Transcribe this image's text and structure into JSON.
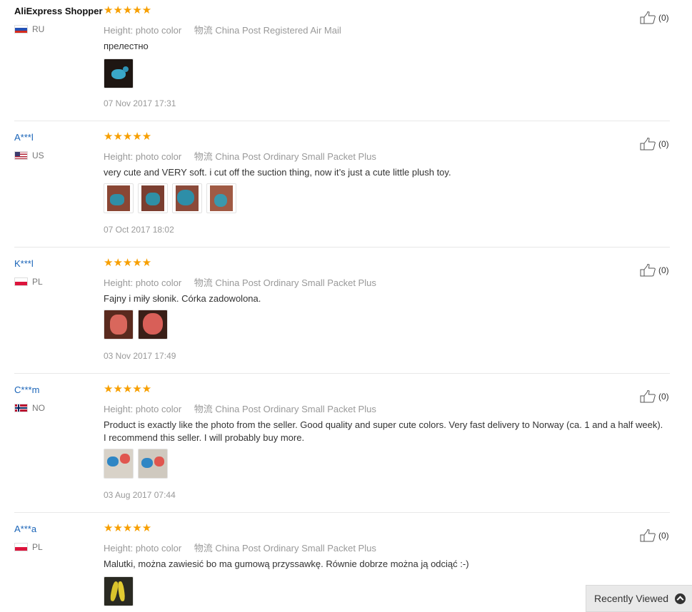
{
  "reviews": [
    {
      "user": "AliExpress Shopper",
      "country": "RU",
      "stars": "★★★★★",
      "height_label": "Height:",
      "height_value": "photo color",
      "logistics_label": "物流",
      "logistics_value": "China Post Registered Air Mail",
      "text": "прелестно",
      "date": "07 Nov 2017 17:31",
      "useful": "(0)"
    },
    {
      "user": "A***l",
      "country": "US",
      "stars": "★★★★★",
      "height_label": "Height:",
      "height_value": "photo color",
      "logistics_label": "物流",
      "logistics_value": "China Post Ordinary Small Packet Plus",
      "text": "very cute and VERY soft. i cut off the suction thing, now it’s just a cute little plush toy.",
      "date": "07 Oct 2017 18:02",
      "useful": "(0)"
    },
    {
      "user": "K***l",
      "country": "PL",
      "stars": "★★★★★",
      "height_label": "Height:",
      "height_value": "photo color",
      "logistics_label": "物流",
      "logistics_value": "China Post Ordinary Small Packet Plus",
      "text": "Fajny i miły słonik. Córka zadowolona.",
      "date": "03 Nov 2017 17:49",
      "useful": "(0)"
    },
    {
      "user": "C***m",
      "country": "NO",
      "stars": "★★★★★",
      "height_label": "Height:",
      "height_value": "photo color",
      "logistics_label": "物流",
      "logistics_value": "China Post Ordinary Small Packet Plus",
      "text": "Product is exactly like the photo from the seller. Good quality and super cute colors. Very fast delivery to Norway (ca. 1 and a half week). I recommend this seller. I will probably buy more.",
      "date": "03 Aug 2017 07:44",
      "useful": "(0)"
    },
    {
      "user": "A***a",
      "country": "PL",
      "stars": "★★★★★",
      "height_label": "Height:",
      "height_value": "photo color",
      "logistics_label": "物流",
      "logistics_value": "China Post Ordinary Small Packet Plus",
      "text": "Malutki, można zawiesić bo ma gumową przyssawkę. Równie dobrze można ją odciąć :-)",
      "date": "",
      "useful": "(0)"
    }
  ],
  "recently_viewed": {
    "label": "Recently Viewed",
    "icon": "chevron-up-icon"
  },
  "colors": {
    "stars": "#f79f00",
    "link": "#1a64b8",
    "muted": "#999999"
  }
}
